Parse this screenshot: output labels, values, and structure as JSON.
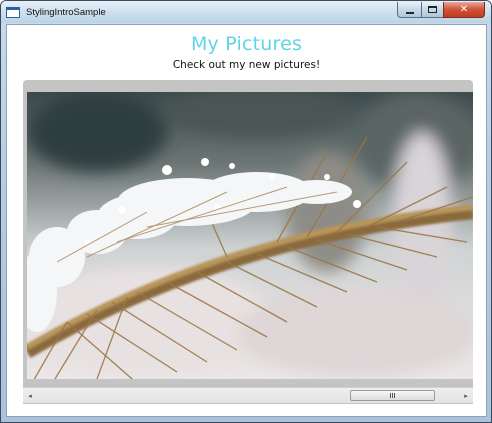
{
  "window": {
    "title": "StylingIntroSample",
    "minimize_icon": "minimize-icon",
    "maximize_icon": "maximize-icon",
    "close_icon": "close-icon",
    "close_glyph": "✕"
  },
  "content": {
    "heading": "My Pictures",
    "heading_color": "#5fd4e6",
    "subheading": "Check out my new pictures!"
  },
  "viewer": {
    "image": "photo-frosted-grass-seed-head",
    "scrollbar": {
      "left_arrow": "◂",
      "right_arrow": "▸",
      "position": 0.93
    }
  }
}
